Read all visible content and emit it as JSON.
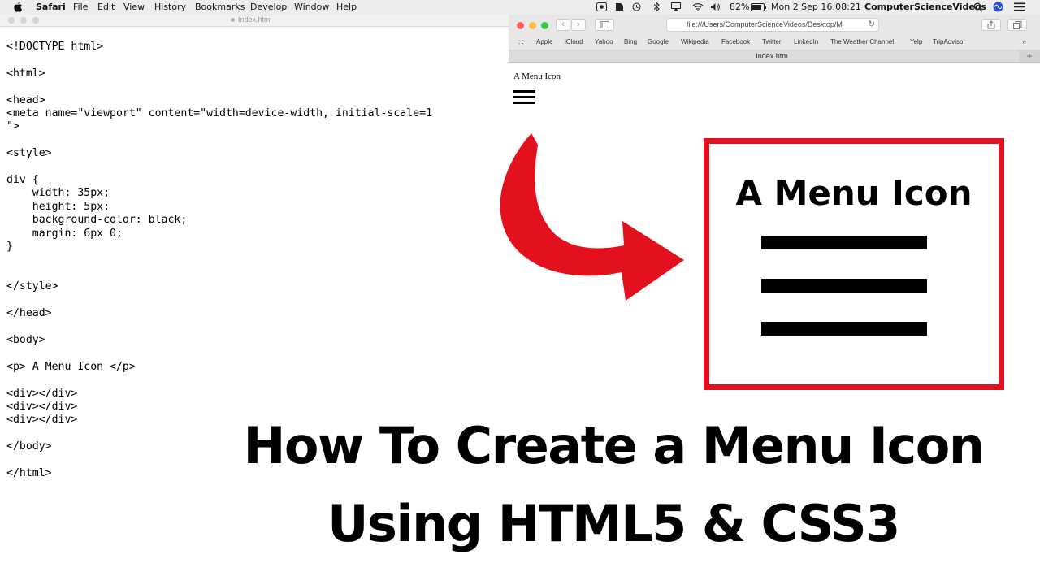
{
  "menubar": {
    "app_name": "Safari",
    "menus": [
      "File",
      "Edit",
      "View",
      "History",
      "Bookmarks",
      "Develop",
      "Window",
      "Help"
    ],
    "battery": "82%",
    "clock": "Mon 2 Sep  16:08:21",
    "user": "ComputerScienceVideos"
  },
  "editor": {
    "title": "Index.htm",
    "code": "<!DOCTYPE html>\n\n<html>\n\n<head>\n<meta name=\"viewport\" content=\"width=device-width, initial-scale=1\n\">\n\n<style>\n\ndiv {\n    width: 35px;\n    height: 5px;\n    background-color: black;\n    margin: 6px 0;\n}\n\n\n</style>\n\n</head>\n\n<body>\n\n<p> A Menu Icon </p>\n\n<div></div>\n<div></div>\n<div></div>\n\n</body>\n\n</html>"
  },
  "browser": {
    "address": "file:///Users/ComputerScienceVideos/Desktop/M",
    "favorites": [
      "Apple",
      "iCloud",
      "Yahoo",
      "Bing",
      "Google",
      "Wikipedia",
      "Facebook",
      "Twitter",
      "LinkedIn",
      "The Weather Channel",
      "Yelp",
      "TripAdvisor"
    ],
    "tab_title": "Index.htm",
    "page_text": "A Menu Icon"
  },
  "overlay": {
    "zoom_title": "A Menu Icon",
    "caption_line1": "How To Create a Menu Icon",
    "caption_line2": "Using HTML5 & CSS3"
  },
  "colors": {
    "accent_red": "#e3101e",
    "close": "#fc605c",
    "minimize": "#fdbc40",
    "zoom": "#34c84a"
  }
}
